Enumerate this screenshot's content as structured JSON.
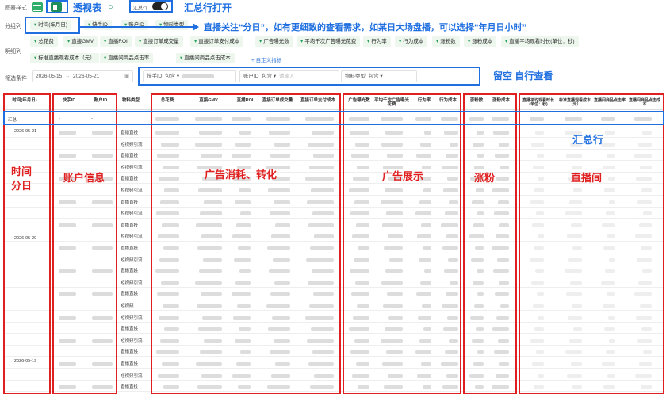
{
  "toolbar": {
    "chart_style_label": "图表样式",
    "pivot_annotation": "透视表",
    "summary_toggle_label": "汇总行",
    "summary_annotation": "汇总行打开"
  },
  "group_columns": {
    "label": "分组列",
    "items": [
      "时间(年月日)",
      "快手ID",
      "账户ID",
      "物料类型"
    ],
    "annotation": "直播关注“分日”，如有更细致的查看需求，如某日大场盘播，可以选择“年月日小时”"
  },
  "detail_columns": {
    "label": "明细列",
    "items": [
      "总花费",
      "直接GMV",
      "直播ROI",
      "直接订单成交量",
      "直接订单支付成本",
      "广告曝光数",
      "平均千次广告曝光花费",
      "行为率",
      "行为成本",
      "涨粉数",
      "涨粉成本",
      "直播平均观看时长(单位：秒)",
      "标准直播观看成本（元）",
      "直播间商品点击率",
      "直播间商品点击成本"
    ],
    "add_label": "+ 自定义指标"
  },
  "filters": {
    "label": "筛选条件",
    "date_start": "2026-05-15",
    "date_sep": "→",
    "date_end": "2026-05-21",
    "kuaishou_id_label": "快手ID",
    "contains_1": "包含",
    "account_id_label": "账户ID",
    "contains_2": "包含",
    "input_placeholder": "请输入",
    "material_label": "物料类型",
    "contains_3": "包含",
    "annotation": "留空 自行查看"
  },
  "table": {
    "headers": [
      "时间(年月日)",
      "快手ID",
      "账户ID",
      "物料类型",
      "总花费",
      "直接GMV",
      "直播ROI",
      "直接订单成交量",
      "直接订单支付成本",
      "广告曝光数",
      "平均千次广告曝光花费",
      "行为率",
      "行为成本",
      "涨粉数",
      "涨粉成本",
      "直播平均观看时长(单位：秒)",
      "标准直播观看成本（元）",
      "直播间商品点击率",
      "直播间商品点击成本"
    ],
    "summary_label": "汇总: -",
    "summary_dash_1": "-",
    "summary_dash_2": "-",
    "dates": [
      "2026-05-21",
      "2026-05-20",
      "2026-05-19"
    ],
    "material_types": [
      "直播直投",
      "短视频引流",
      "直播直投",
      "短视频引流",
      "直播直投",
      "短视频引流",
      "直播直投",
      "短视频引流",
      "直播直投",
      "短视频引流",
      "直播直投",
      "短视频引流",
      "直播直投",
      "短视频引流",
      "直播直投",
      "短视频",
      "短视频引流",
      "直播直投",
      "短视频引流",
      "直播直投",
      "直播直投",
      "短视频引流",
      "直播直投"
    ]
  },
  "annotations": {
    "time": "时间\n分日",
    "account": "账户信息",
    "ad_cost": "广告消耗、转化",
    "ad_show": "广告展示",
    "fans": "涨粉",
    "summary_row": "汇总行",
    "live": "直播间"
  }
}
